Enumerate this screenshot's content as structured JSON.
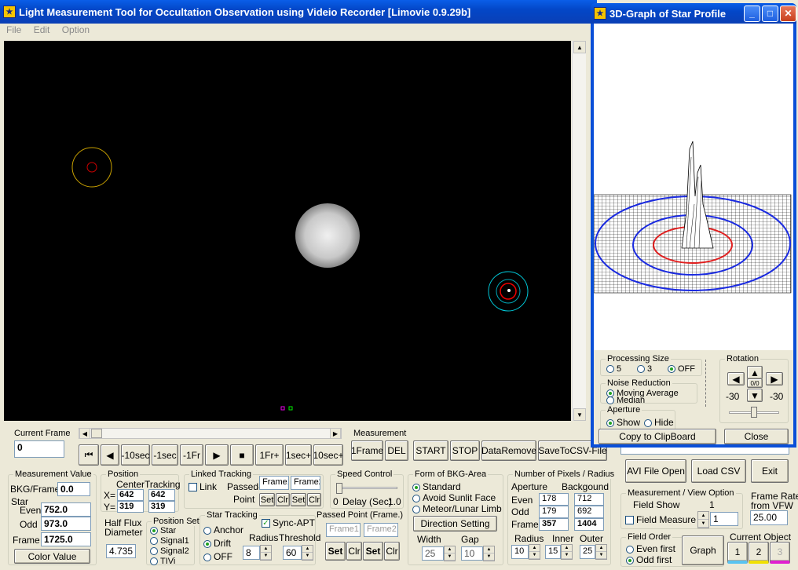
{
  "main_window": {
    "title": "Light Measurement Tool for Occultation Observation using Videio Recorder [Limovie 0.9.29b]",
    "menu": [
      "File",
      "Edit",
      "Option"
    ]
  },
  "graph_window": {
    "title": "3D-Graph of Star Profile",
    "processing_size": {
      "title": "Processing Size",
      "options": [
        "5",
        "3",
        "OFF"
      ],
      "selected": "OFF"
    },
    "noise_reduction": {
      "title": "Noise Reduction",
      "options": [
        "Moving Average",
        "Median"
      ],
      "selected": "Moving Average"
    },
    "aperture": {
      "title": "Aperture",
      "options": [
        "Show",
        "Hide"
      ],
      "selected": "Show"
    },
    "rotation": {
      "title": "Rotation",
      "left_value": "-30",
      "right_value": "-30",
      "center": "0/0"
    },
    "copy_button": "Copy to ClipBoard",
    "close_button": "Close"
  },
  "playback": {
    "current_frame_label": "Current Frame",
    "current_frame": "0",
    "buttons": [
      "⏮",
      "◀",
      "-10sec",
      "-1sec",
      "-1Fr",
      "▶",
      "■",
      "1Fr+",
      "1sec+",
      "10sec+"
    ]
  },
  "measurement": {
    "title": "Measurement",
    "buttons": [
      "1Frame",
      "DEL",
      "START",
      "STOP",
      "DataRemove",
      "SaveToCSV-File"
    ]
  },
  "avi_file": "AVI File Info: (truncated path)",
  "right_buttons": {
    "avi_open": "AVI File Open",
    "load_csv": "Load CSV",
    "exit": "Exit"
  },
  "measurement_value": {
    "title": "Measurement Value",
    "bkg_label": "BKG/Frame",
    "bkg": "0.0",
    "star_label": "Star",
    "even_label": "Even",
    "even": "752.0",
    "odd_label": "Odd",
    "odd": "973.0",
    "frame_label": "Frame",
    "frame": "1725.0",
    "color_button": "Color Value"
  },
  "position": {
    "title": "Position",
    "center": "Center",
    "tracking": "Tracking",
    "x_label": "X=",
    "y_label": "Y=",
    "x_center": "642",
    "x_tracking": "642",
    "y_center": "319",
    "y_tracking": "319"
  },
  "half_flux": {
    "title_1": "Half Flux",
    "title_2": "Diameter",
    "value": "4.735"
  },
  "position_set": {
    "title": "Position Set",
    "options": [
      "Star",
      "Signal1",
      "Signal2",
      "TIVi"
    ],
    "selected": "Star"
  },
  "linked_tracking": {
    "title": "Linked Tracking",
    "link": "Link",
    "passed_point_1": "Passed-",
    "passed_point_2": "Point",
    "frame1": "Frame1",
    "frame2": "Frame2",
    "set": "Set",
    "clr": "Clr"
  },
  "star_tracking": {
    "title": "Star Tracking",
    "options": [
      "Anchor",
      "Drift",
      "OFF"
    ],
    "selected": "Drift",
    "sync_apt": "Sync-APT",
    "radius_label": "Radius",
    "radius": "8",
    "threshold_label": "Threshold",
    "threshold": "60"
  },
  "speed_control": {
    "title": "Speed Control",
    "zero": "0",
    "delay": "Delay (Sec)",
    "max": "1.0"
  },
  "passed_point_frame": {
    "title": "Passed Point (Frame.)",
    "frame1": "Frame1",
    "frame2": "Frame2",
    "set": "Set",
    "clr": "Clr"
  },
  "bkg_area": {
    "title": "Form of BKG-Area",
    "options": [
      "Standard",
      "Avoid Sunlit Face",
      "Meteor/Lunar Limb"
    ],
    "selected": "Standard",
    "direction_button": "Direction Setting",
    "width_label": "Width",
    "width": "25",
    "gap_label": "Gap",
    "gap": "10"
  },
  "pixels": {
    "title": "Number of Pixels / Radius",
    "aperture": "Aperture",
    "background": "Backgound",
    "even_label": "Even",
    "even_ap": "178",
    "even_bg": "712",
    "odd_label": "Odd",
    "odd_ap": "179",
    "odd_bg": "692",
    "frame_label": "Frame",
    "frame_ap": "357",
    "frame_bg": "1404",
    "radius_label": "Radius",
    "radius": "10",
    "inner_label": "Inner",
    "inner": "15",
    "outer_label": "Outer",
    "outer": "25"
  },
  "view_option": {
    "title": "Measurement / View Option",
    "field_show": "Field Show",
    "field_measure": "Field Measure",
    "interval_label": "Interval",
    "interval": "1"
  },
  "frame_rate": {
    "title_1": "Frame Rate",
    "title_2": "from VFW",
    "value": "25.00"
  },
  "field_order": {
    "title": "Field Order",
    "options": [
      "Even first",
      "Odd first"
    ],
    "selected": "Odd first",
    "graph_button": "Graph"
  },
  "current_object": {
    "title": "Current Object",
    "buttons": [
      "1",
      "2",
      "3"
    ]
  }
}
